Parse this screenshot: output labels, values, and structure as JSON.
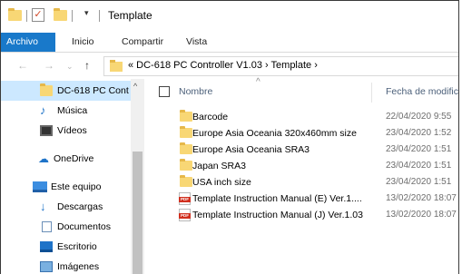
{
  "window": {
    "title": "Template"
  },
  "ribbon": {
    "tabs": [
      {
        "label": "Archivo",
        "active": true
      },
      {
        "label": "Inicio"
      },
      {
        "label": "Compartir"
      },
      {
        "label": "Vista"
      }
    ]
  },
  "address": {
    "path": "« DC-618 PC Controller V1.03 › Template ›"
  },
  "navpane": {
    "items": [
      {
        "label": "DC-618 PC Cont",
        "icon": "folder-icon",
        "selected": true
      },
      {
        "label": "Música",
        "icon": "music-icon"
      },
      {
        "label": "Vídeos",
        "icon": "video-icon"
      },
      {
        "label": "OneDrive",
        "icon": "cloud-icon"
      },
      {
        "label": "Este equipo",
        "icon": "computer-icon"
      },
      {
        "label": "Descargas",
        "icon": "download-icon"
      },
      {
        "label": "Documentos",
        "icon": "document-icon"
      },
      {
        "label": "Escritorio",
        "icon": "desktop-icon"
      },
      {
        "label": "Imágenes",
        "icon": "pictures-icon"
      }
    ]
  },
  "content": {
    "columns": {
      "name": "Nombre",
      "date": "Fecha de modific"
    },
    "files": [
      {
        "name": "Barcode",
        "date": "22/04/2020 9:55",
        "type": "folder"
      },
      {
        "name": "Europe Asia Oceania 320x460mm size",
        "date": "23/04/2020 1:52",
        "type": "folder"
      },
      {
        "name": "Europe Asia Oceania SRA3",
        "date": "23/04/2020 1:51",
        "type": "folder"
      },
      {
        "name": "Japan SRA3",
        "date": "23/04/2020 1:51",
        "type": "folder"
      },
      {
        "name": "USA inch size",
        "date": "23/04/2020 1:51",
        "type": "folder"
      },
      {
        "name": "Template Instruction Manual (E) Ver.1....",
        "date": "13/02/2020 18:07",
        "type": "pdf"
      },
      {
        "name": "Template Instruction Manual (J) Ver.1.03",
        "date": "13/02/2020 18:07",
        "type": "pdf"
      }
    ]
  },
  "colors": {
    "accent": "#1979ca",
    "folder": "#f8d775",
    "selection": "#cce8ff",
    "pdf": "#d1301f"
  }
}
